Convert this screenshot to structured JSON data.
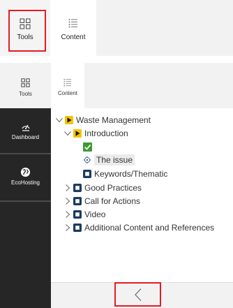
{
  "top_toolbar": {
    "tools_label": "Tools",
    "content_label": "Content"
  },
  "panel": {
    "tabs": [
      {
        "label": "Tools",
        "icon": "grid-icon"
      },
      {
        "label": "Content",
        "icon": "list-icon"
      }
    ],
    "sidebar": {
      "items": [
        {
          "label": "Dashboard",
          "icon": "dashboard-icon"
        },
        {
          "label": "EcoHosting",
          "icon": "globe-icon"
        }
      ]
    },
    "tree": {
      "root": "Waste Management",
      "introduction": "Introduction",
      "the_issue": "The issue",
      "keywords": "Keywords/Thematic",
      "good_practices": "Good Practices",
      "call_for_actions": "Call for Actions",
      "video": "Video",
      "additional": "Additional Content and References"
    },
    "back_icon": "chevron-left-icon"
  },
  "colors": {
    "highlight": "#e51c23",
    "module_yellow": "#f5c400",
    "check_green": "#3d9a32",
    "page_icon_navy": "#1c3b5e",
    "sidebar_bg": "#262626"
  }
}
